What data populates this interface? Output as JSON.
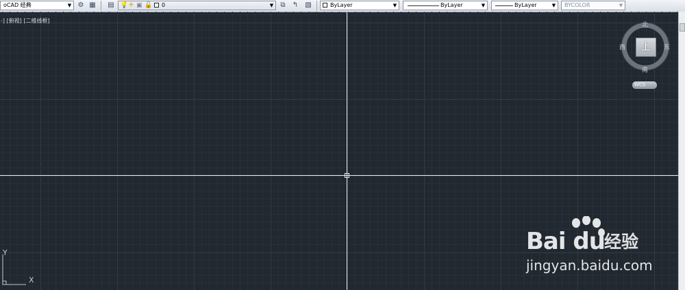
{
  "toolbar": {
    "workspace": "oCAD 经典",
    "layer_name": "0",
    "color_value": "ByLayer",
    "linetype_value": "ByLayer",
    "lineweight_value": "ByLayer",
    "plotstyle_value": "BYCOLOR"
  },
  "viewport": {
    "label": "-] [俯视] [二维线框]"
  },
  "viewcube": {
    "north": "北",
    "south": "南",
    "east": "东",
    "west": "西",
    "face": "上",
    "wcs": "WCS"
  },
  "ucs": {
    "x": "X",
    "y": "Y"
  },
  "watermark": {
    "brand": "Bai du",
    "brand_suffix": "经验",
    "url": "jingyan.baidu.com"
  },
  "colors": {
    "canvas": "#212830",
    "grid_minor": "#283039",
    "grid_major": "#333c46",
    "crosshair": "#e8ecf0"
  }
}
